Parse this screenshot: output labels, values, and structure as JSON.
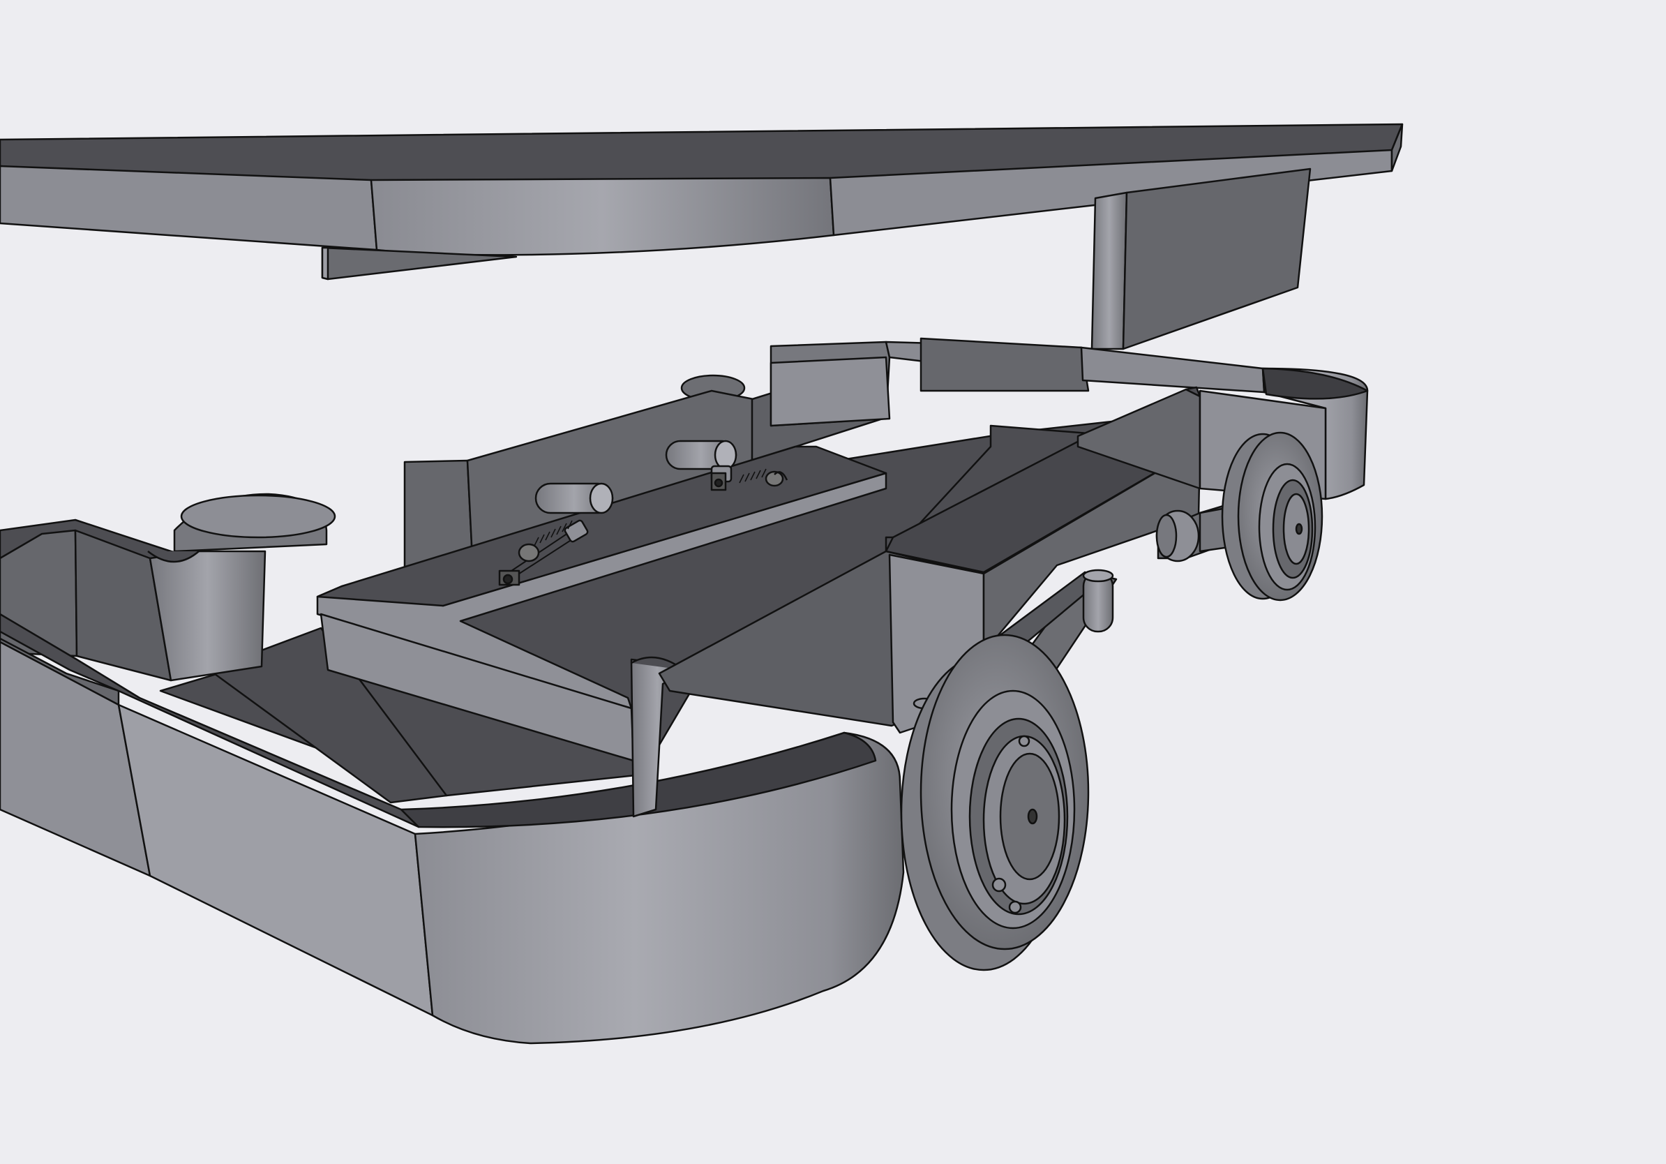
{
  "viewport": {
    "background": "#ededf1",
    "render_style": "shaded-with-edges",
    "model": {
      "parts": [
        "top-deck",
        "deck-support",
        "chassis-frame",
        "front-wheel",
        "rear-wheel",
        "caster-wheel",
        "suspension-spring",
        "pivot-pin"
      ]
    }
  },
  "colors": {
    "edge": "#111111",
    "face_light": "#a7a7ae",
    "face_mid": "#8f9097",
    "face_dark": "#66676c",
    "face_darker": "#4e4e53",
    "face_darkest": "#3c3c40"
  }
}
